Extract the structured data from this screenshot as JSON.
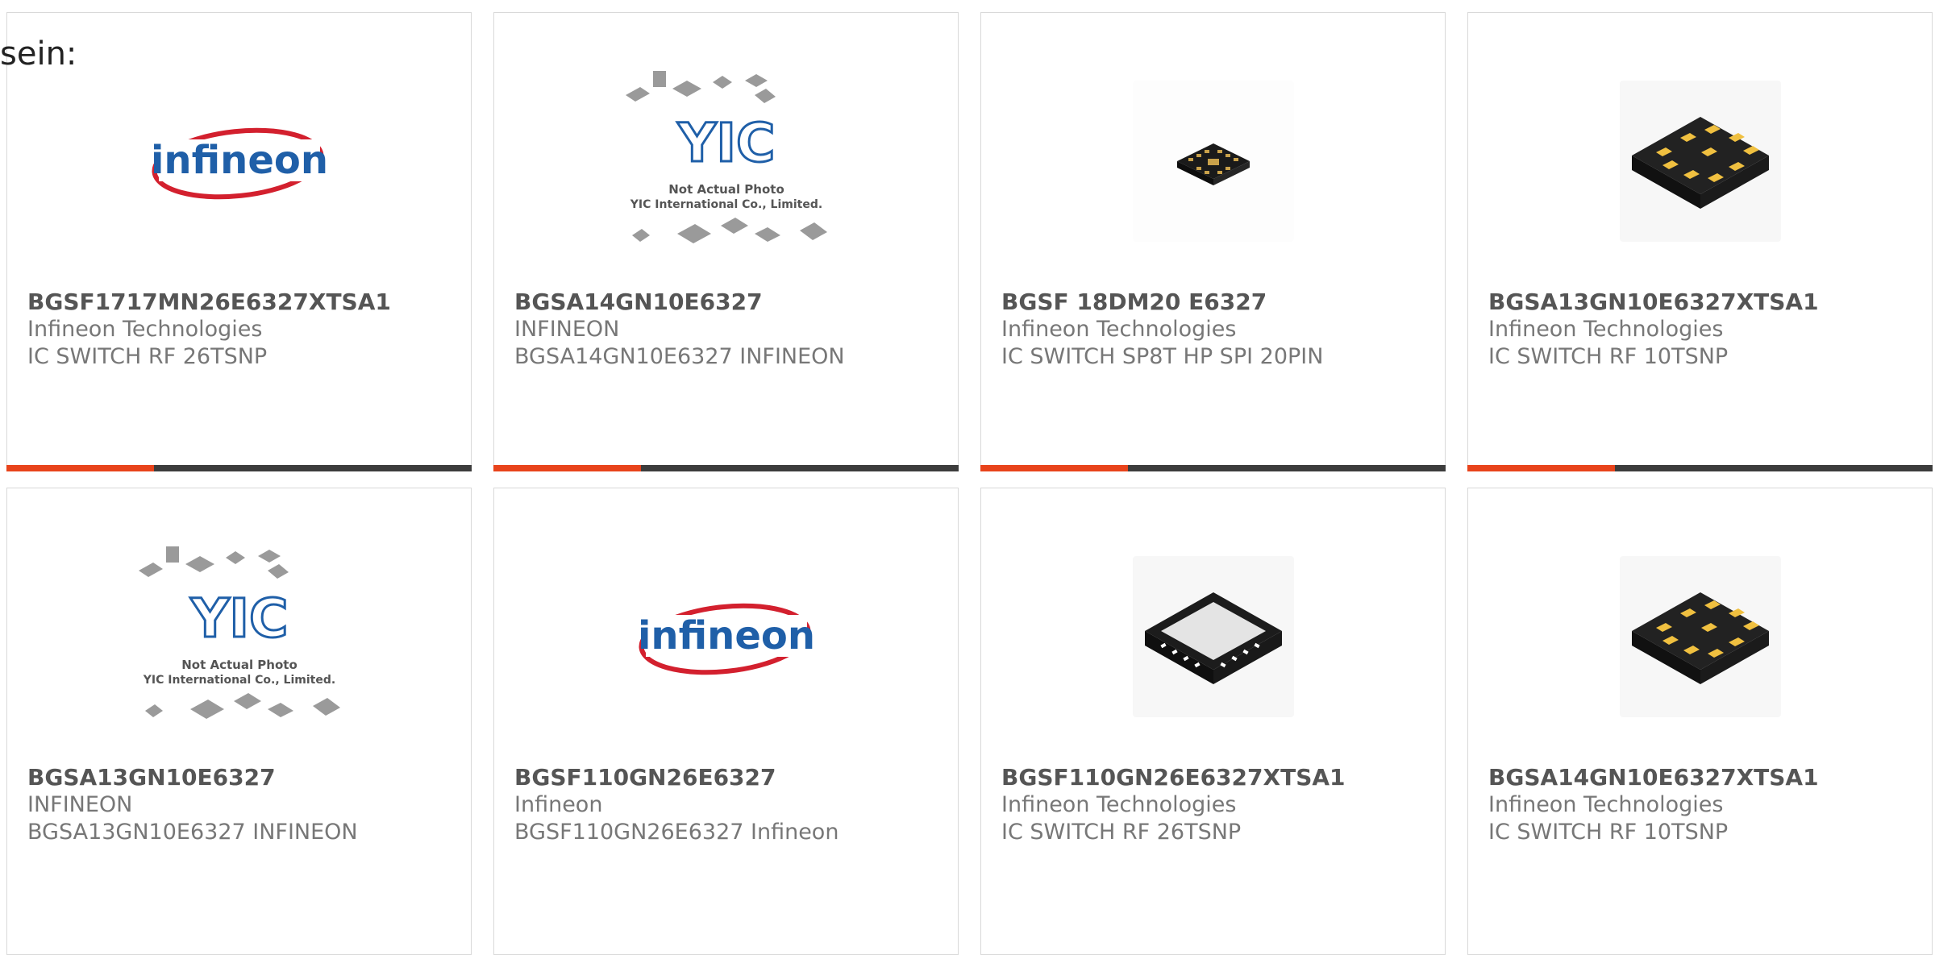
{
  "intro_text": "sein:",
  "colors": {
    "accent": "#e8431b",
    "bar": "#3c3c3c",
    "border": "#d9d9d9",
    "brand_red": "#d3202e",
    "brand_blue": "#1f5fa8"
  },
  "icons": {
    "chip_package": "ic-chip-icon",
    "logo": "infineon-logo",
    "placeholder": "yic-not-actual-photo"
  },
  "placeholder": {
    "logo_text": "YIC",
    "line1": "Not Actual Photo",
    "line2": "YIC International Co., Limited."
  },
  "brand_logo_text": "infineon",
  "cards": [
    {
      "part_number": "BGSF1717MN26E6327XTSA1",
      "manufacturer": "Infineon Technologies",
      "description": "IC SWITCH RF 26TSNP",
      "image": "infineon-logo"
    },
    {
      "part_number": "BGSA14GN10E6327",
      "manufacturer": "INFINEON",
      "description": "BGSA14GN10E6327 INFINEON",
      "image": "yic-not-actual-photo"
    },
    {
      "part_number": "BGSF 18DM20 E6327",
      "manufacturer": "Infineon Technologies",
      "description": "IC SWITCH SP8T HP SPI 20PIN",
      "image": "small-qfn-chip"
    },
    {
      "part_number": "BGSA13GN10E6327XTSA1",
      "manufacturer": "Infineon Technologies",
      "description": "IC SWITCH RF 10TSNP",
      "image": "lga-10pad-chip"
    },
    {
      "part_number": "BGSA13GN10E6327",
      "manufacturer": "INFINEON",
      "description": "BGSA13GN10E6327 INFINEON",
      "image": "yic-not-actual-photo"
    },
    {
      "part_number": "BGSF110GN26E6327",
      "manufacturer": "Infineon",
      "description": "BGSF110GN26E6327 Infineon",
      "image": "infineon-logo"
    },
    {
      "part_number": "BGSF110GN26E6327XTSA1",
      "manufacturer": "Infineon Technologies",
      "description": "IC SWITCH RF 26TSNP",
      "image": "qfn-26pin-chip"
    },
    {
      "part_number": "BGSA14GN10E6327XTSA1",
      "manufacturer": "Infineon Technologies",
      "description": "IC SWITCH RF 10TSNP",
      "image": "lga-10pad-chip"
    }
  ]
}
